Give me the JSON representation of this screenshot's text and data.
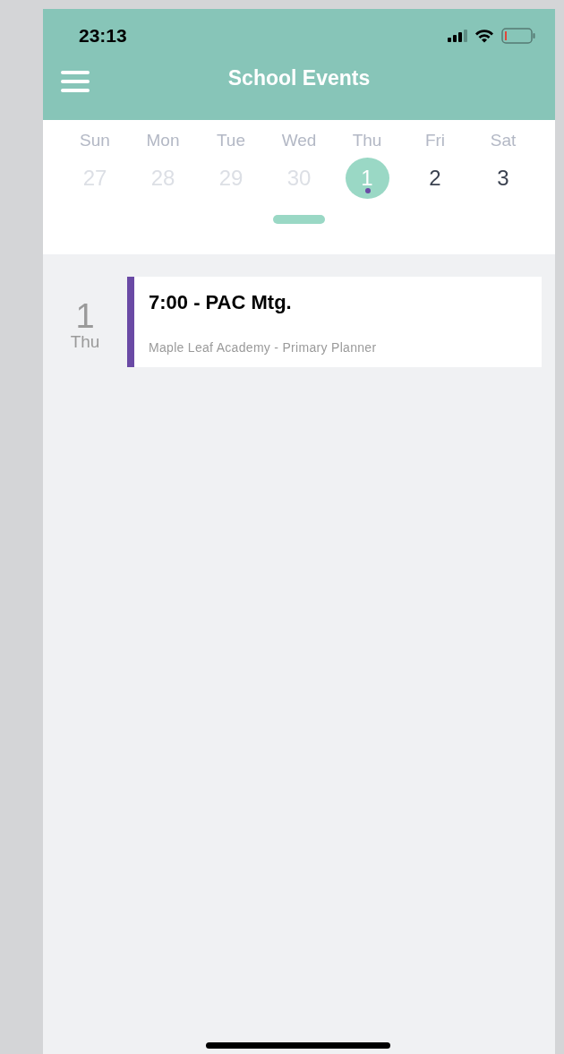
{
  "status_bar": {
    "time": "23:13"
  },
  "header": {
    "title": "School Events"
  },
  "week": [
    {
      "weekday": "Sun",
      "date": "27",
      "outside_month": true,
      "selected": false,
      "has_event": false
    },
    {
      "weekday": "Mon",
      "date": "28",
      "outside_month": true,
      "selected": false,
      "has_event": false
    },
    {
      "weekday": "Tue",
      "date": "29",
      "outside_month": true,
      "selected": false,
      "has_event": false
    },
    {
      "weekday": "Wed",
      "date": "30",
      "outside_month": true,
      "selected": false,
      "has_event": false
    },
    {
      "weekday": "Thu",
      "date": "1",
      "outside_month": false,
      "selected": true,
      "has_event": true
    },
    {
      "weekday": "Fri",
      "date": "2",
      "outside_month": false,
      "selected": false,
      "has_event": false
    },
    {
      "weekday": "Sat",
      "date": "3",
      "outside_month": false,
      "selected": false,
      "has_event": false
    }
  ],
  "events": [
    {
      "day": "1",
      "weekday": "Thu",
      "title": "7:00 - PAC Mtg.",
      "calendar": "Maple Leaf Academy - Primary Planner",
      "color": "#6a4aa5"
    }
  ]
}
